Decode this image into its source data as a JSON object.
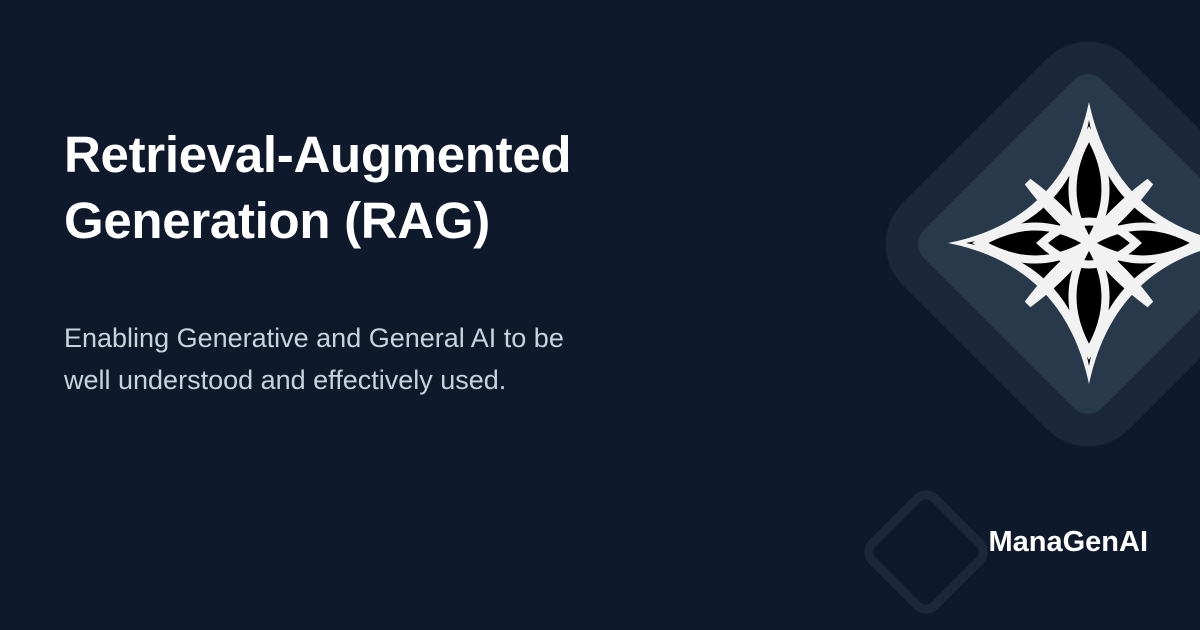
{
  "title": {
    "line1": "Retrieval-Augmented",
    "line2": "Generation (RAG)"
  },
  "subtitle": {
    "line1": "Enabling Generative and General AI to be",
    "line2": "well understood and effectively used."
  },
  "brand": {
    "name": "ManaGenAI"
  },
  "colors": {
    "background": "#0e1a2b",
    "panel_outer": "#1a2839",
    "panel_inner": "#28394c",
    "title": "#ffffff",
    "subtitle": "#c9d3e0",
    "logo_fill": "#f2f2f2",
    "logo_cut": "#000000"
  },
  "icons": {
    "logo": "ornate-diamond-logo-icon",
    "decoration": "rounded-diamond-outline"
  }
}
